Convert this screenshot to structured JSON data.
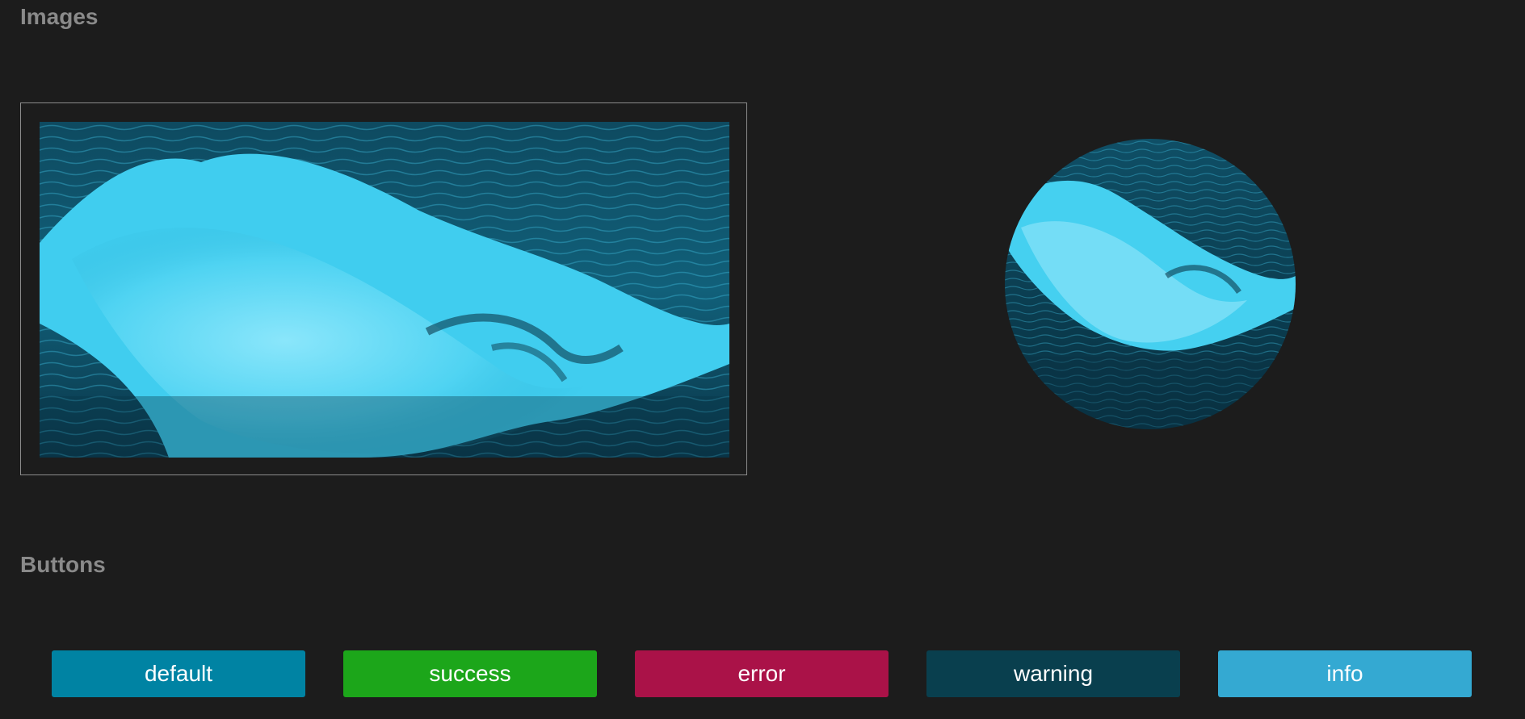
{
  "sections": {
    "images_title": "Images",
    "buttons_title": "Buttons"
  },
  "images": {
    "rect_image": {
      "subject": "ocean wave (cyan tint)",
      "tint": "#35c8ea",
      "dark": "#062a38"
    },
    "circle_image": {
      "subject": "ocean wave (cyan tint)",
      "tint": "#35c8ea",
      "dark": "#062a38"
    }
  },
  "buttons": [
    {
      "label": "default",
      "color": "#0083a3"
    },
    {
      "label": "success",
      "color": "#1ca61a"
    },
    {
      "label": "error",
      "color": "#aa1248"
    },
    {
      "label": "warning",
      "color": "#093f4e"
    },
    {
      "label": "info",
      "color": "#34a9d2"
    }
  ],
  "colors": {
    "background": "#1c1c1c",
    "heading": "#8a8a8a",
    "frame_border": "#8c8c8c"
  }
}
